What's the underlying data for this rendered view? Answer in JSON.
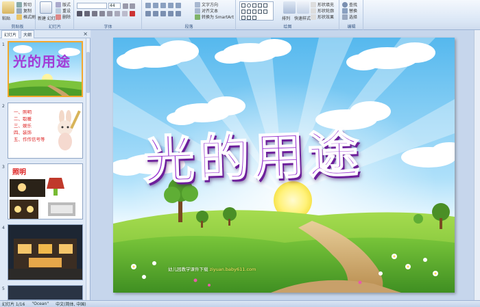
{
  "ribbon": {
    "clipboard": {
      "paste": "粘贴",
      "cut": "剪切",
      "copy": "复制",
      "format_painter": "格式刷",
      "label": "剪贴板"
    },
    "slides": {
      "new_slide": "新建\n幻灯片",
      "layout": "版式",
      "reset": "重设",
      "delete": "删除",
      "label": "幻灯片"
    },
    "font": {
      "font_size": "44",
      "label": "字体"
    },
    "paragraph": {
      "text_direction": "文字方向",
      "align_text": "对齐文本",
      "smartart": "转换为 SmartArt",
      "label": "段落"
    },
    "drawing": {
      "arrange": "排列",
      "quick_styles": "快速样式",
      "shape_fill": "形状填充",
      "shape_outline": "形状轮廓",
      "shape_effects": "形状效果",
      "label": "绘图"
    },
    "editing": {
      "find": "查找",
      "replace": "替换",
      "select": "选择",
      "label": "编辑"
    }
  },
  "panel": {
    "tabs": [
      "幻灯片",
      "大纲"
    ],
    "close": "×",
    "slides": [
      {
        "number": "1",
        "title": "光的用途"
      },
      {
        "number": "2",
        "items": [
          "一、照明",
          "二、取暖",
          "三、娱乐",
          "四、装饰",
          "五、作作信号等"
        ]
      },
      {
        "number": "3",
        "title": "照明"
      },
      {
        "number": "4"
      },
      {
        "number": "5"
      }
    ]
  },
  "slide": {
    "title": "光的用途",
    "footer": "幼儿园教学课件下载",
    "footer_url": "ziyuan.baby611.com"
  },
  "status": {
    "slide_position": "幻灯片 1/16",
    "theme": "\"Ocean\"",
    "language": "中文(简体, 中国)"
  }
}
